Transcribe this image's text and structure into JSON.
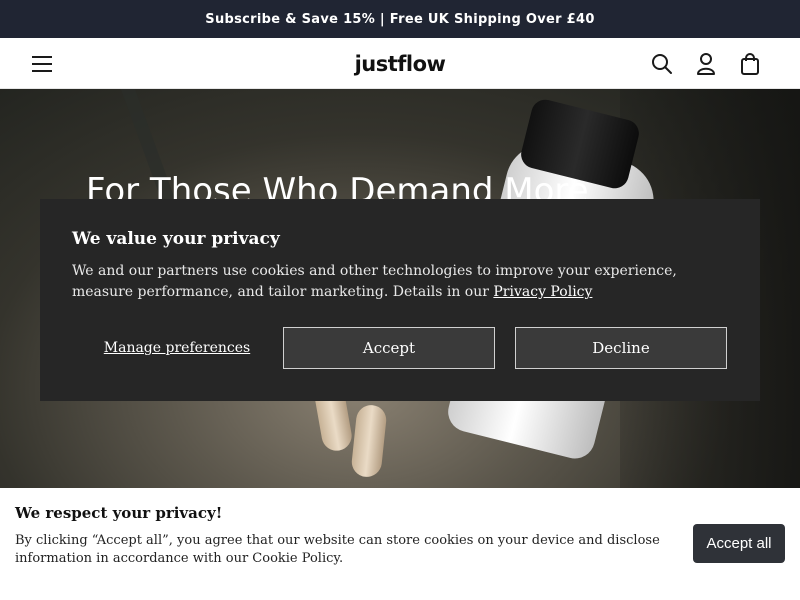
{
  "announcement": {
    "text": "Subscribe & Save 15% | Free UK Shipping Over £40"
  },
  "header": {
    "logo": "justflow",
    "icons": [
      "menu-icon",
      "search-icon",
      "account-icon",
      "bag-icon"
    ]
  },
  "hero": {
    "title": "For Those Who Demand More"
  },
  "cookie_modal": {
    "title": "We value your privacy",
    "body": "We and our partners use cookies and other technologies to improve your experience, measure performance, and tailor marketing. Details in our",
    "link": "Privacy Policy",
    "manage_label": "Manage preferences",
    "accept_label": "Accept",
    "decline_label": "Decline"
  },
  "bottom_banner": {
    "title": "We respect your privacy!",
    "text": "By clicking “Accept all”, you agree that our website can store cookies on your device and disclose information in accordance with our Cookie Policy.",
    "accept_all_label": "Accept all"
  },
  "colors": {
    "announcement_bg": "#202533",
    "modal_bg": "#262626",
    "accept_all_bg": "#2f3238"
  }
}
